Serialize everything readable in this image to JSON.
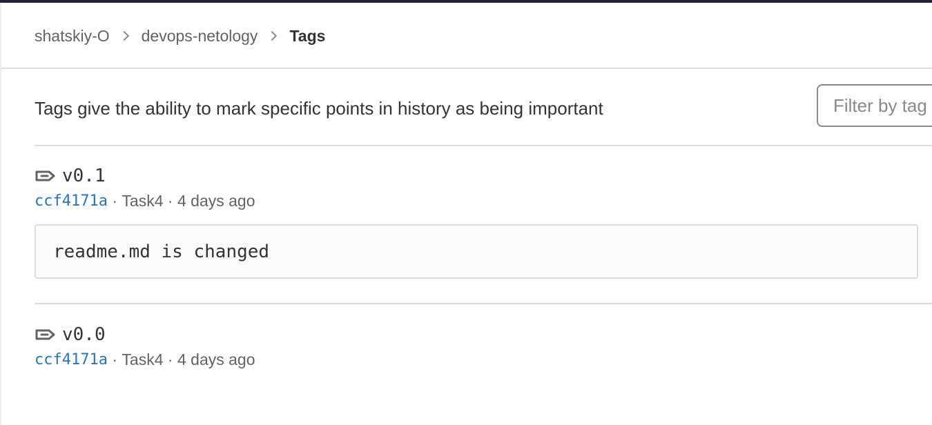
{
  "breadcrumb": {
    "items": [
      "shatskiy-O",
      "devops-netology"
    ],
    "current": "Tags"
  },
  "page": {
    "description": "Tags give the ability to mark specific points in history as being important"
  },
  "filter": {
    "placeholder": "Filter by tag name"
  },
  "tags": [
    {
      "name": "v0.1",
      "commit_sha": "ccf4171a",
      "commit_title": "Task4",
      "time": "4 days ago",
      "message": "readme.md is changed"
    },
    {
      "name": "v0.0",
      "commit_sha": "ccf4171a",
      "commit_title": "Task4",
      "time": "4 days ago"
    }
  ],
  "meta_separator": " · ",
  "icons": {
    "tag": "tag-icon",
    "breadcrumb_separator": "chevron-right-icon"
  },
  "colors": {
    "top_bar": "#1f1e3d",
    "link": "#1f75cb",
    "text": "#333238",
    "muted": "#626168"
  }
}
